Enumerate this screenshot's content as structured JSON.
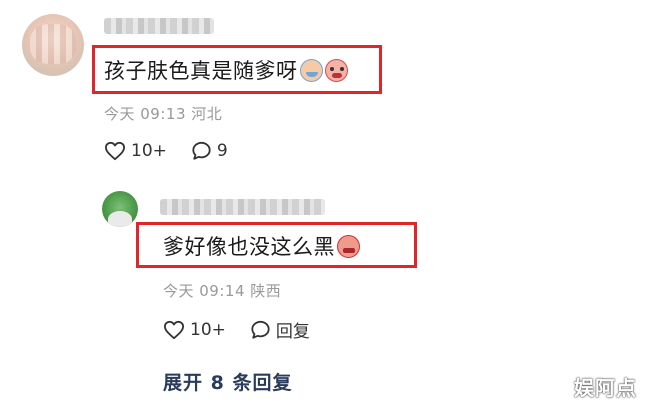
{
  "top_comment": {
    "text": "孩子肤色真是随爹呀",
    "emojis": [
      "sweat-smile-emoji",
      "crying-emoji"
    ],
    "time": "今天 09:13",
    "location": "河北",
    "likes": "10+",
    "replies": "9"
  },
  "reply": {
    "text": "爹好像也没这么黑",
    "emojis": [
      "angry-emoji"
    ],
    "time": "今天 09:14",
    "location": "陕西",
    "likes": "10+",
    "reply_label": "回复"
  },
  "expand_label": "展开 8 条回复",
  "watermark": "娱阿点",
  "colors": {
    "highlight_box": "#e0262b",
    "meta_text": "#999999",
    "expand_text": "#2a3b5c"
  }
}
